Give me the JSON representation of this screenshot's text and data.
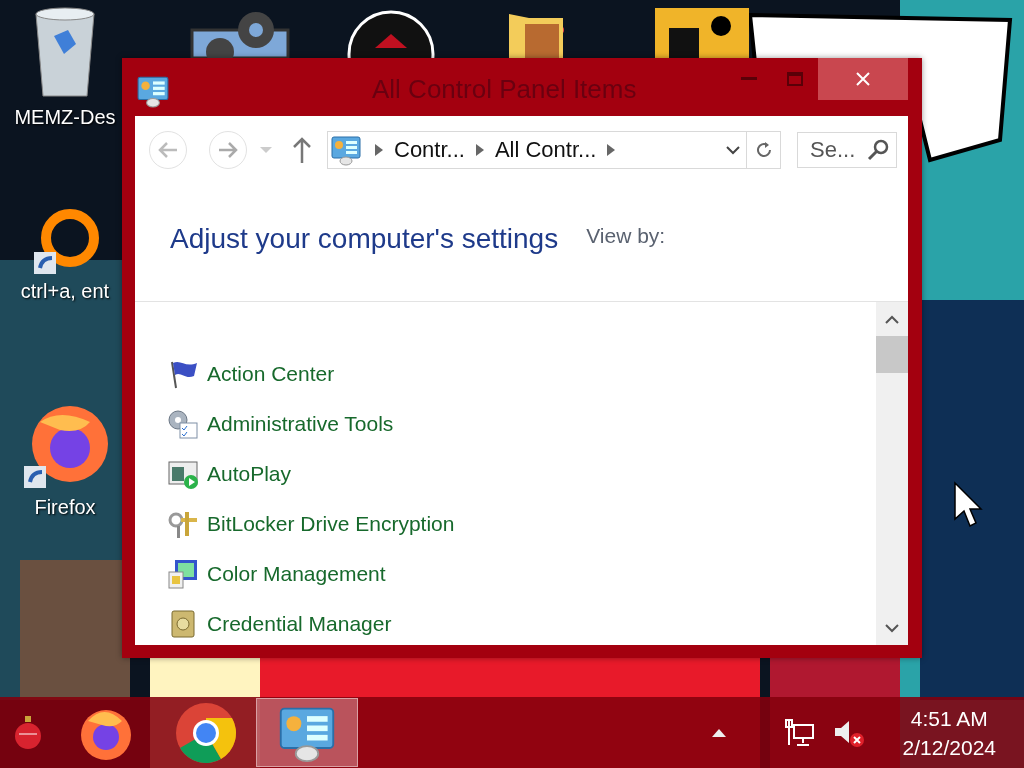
{
  "desktop_icons": [
    {
      "label": "MEMZ-Des"
    },
    {
      "label": "ctrl+a, ent"
    },
    {
      "label": "Firefox"
    }
  ],
  "window": {
    "title": "All Control Panel Items",
    "address": [
      "Contr...",
      "All Contr..."
    ],
    "search": {
      "placeholder": "Se..."
    },
    "heading": "Adjust your computer's settings",
    "view_by": "View by:",
    "items": [
      {
        "label": "Action Center"
      },
      {
        "label": "Administrative Tools"
      },
      {
        "label": "AutoPlay"
      },
      {
        "label": "BitLocker Drive Encryption"
      },
      {
        "label": "Color Management"
      },
      {
        "label": "Credential Manager"
      }
    ]
  },
  "taskbar": {
    "apps": [
      {
        "selected": false
      },
      {
        "selected": false
      },
      {
        "selected": false
      },
      {
        "selected": true
      }
    ],
    "time": "4:51 AM",
    "date": "2/12/2024"
  }
}
